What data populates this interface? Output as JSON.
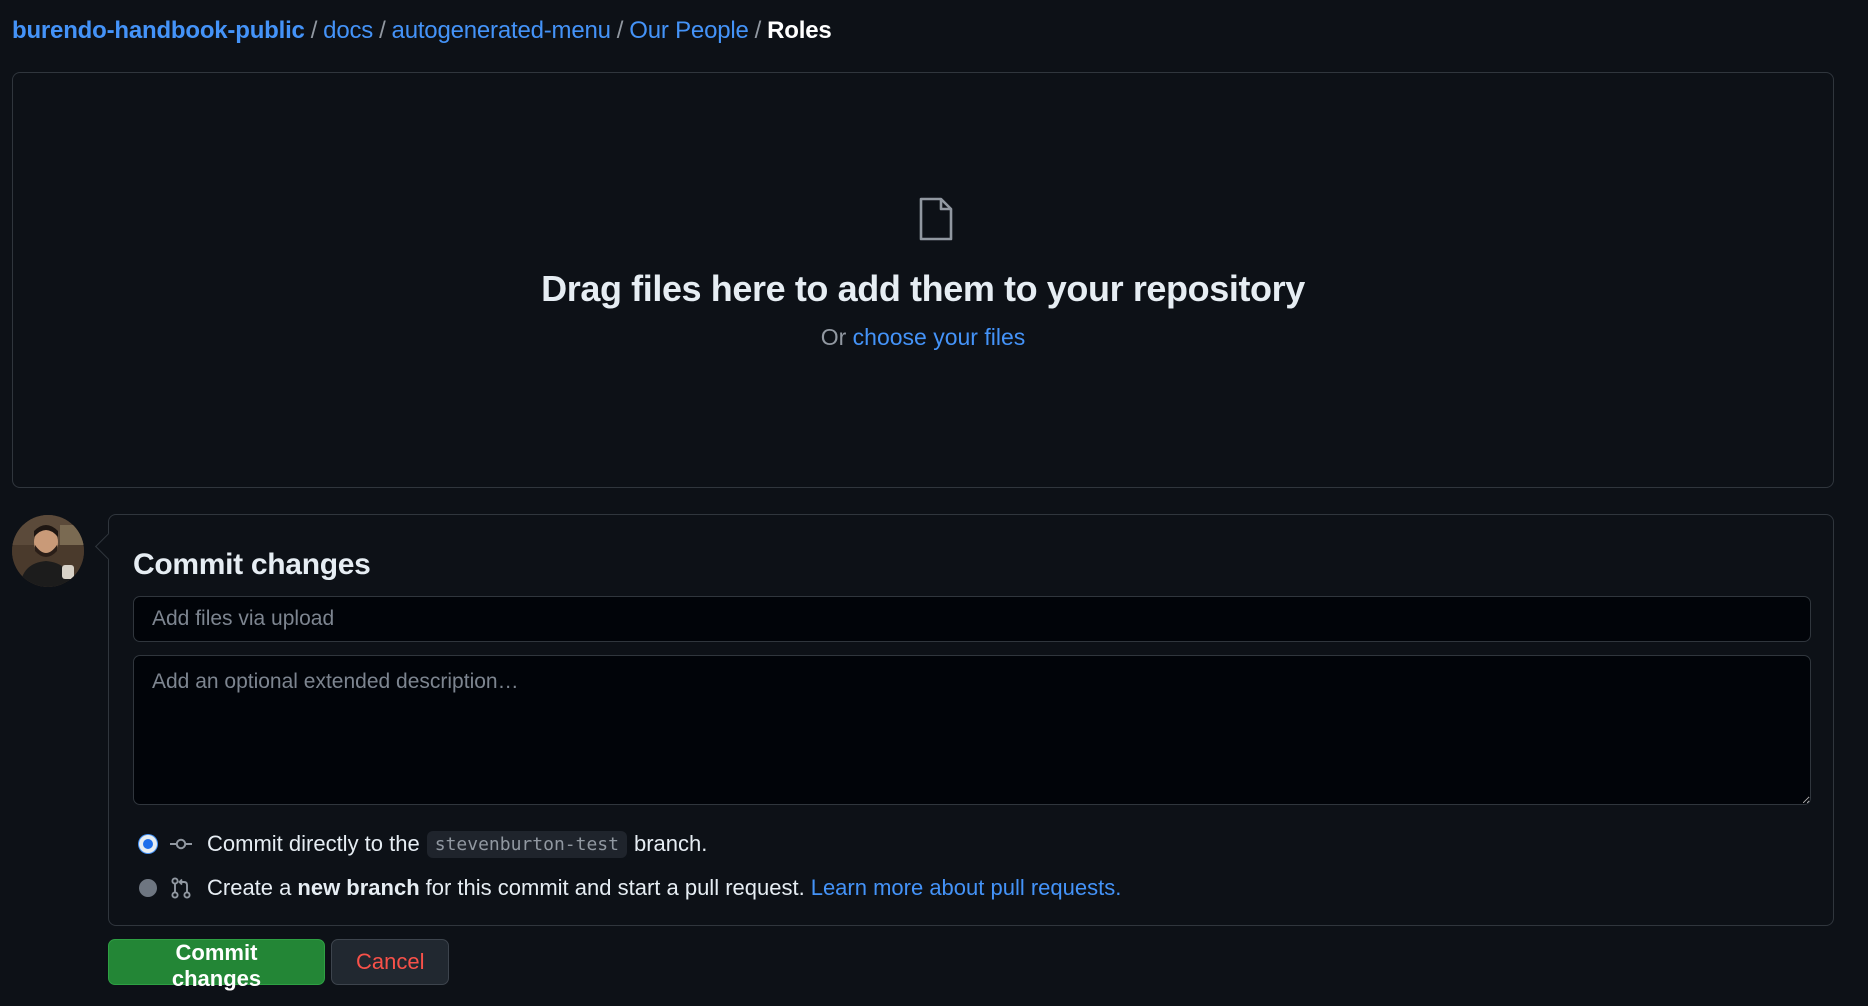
{
  "breadcrumb": {
    "repo": "burendo-handbook-public",
    "separator": "/",
    "path": [
      "docs",
      "autogenerated-menu",
      "Our People"
    ],
    "current": "Roles"
  },
  "dropzone": {
    "icon": "file-icon",
    "title": "Drag files here to add them to your repository",
    "or_text": "Or",
    "choose_link": "choose your files"
  },
  "commit": {
    "title": "Commit changes",
    "summary_placeholder": "Add files via upload",
    "description_placeholder": "Add an optional extended description…",
    "option_direct": {
      "selected": true,
      "icon": "git-commit-icon",
      "prefix": "Commit directly to the",
      "branch": "stevenburton-test",
      "suffix": "branch."
    },
    "option_new_branch": {
      "selected": false,
      "icon": "git-pull-request-icon",
      "prefix": "Create a",
      "bold": "new branch",
      "suffix": "for this commit and start a pull request.",
      "link": "Learn more about pull requests."
    }
  },
  "buttons": {
    "commit": "Commit changes",
    "cancel": "Cancel"
  },
  "colors": {
    "background": "#0d1117",
    "link": "#4493f8",
    "border": "#30363d",
    "commit_button": "#238636",
    "cancel_text": "#f85149"
  }
}
